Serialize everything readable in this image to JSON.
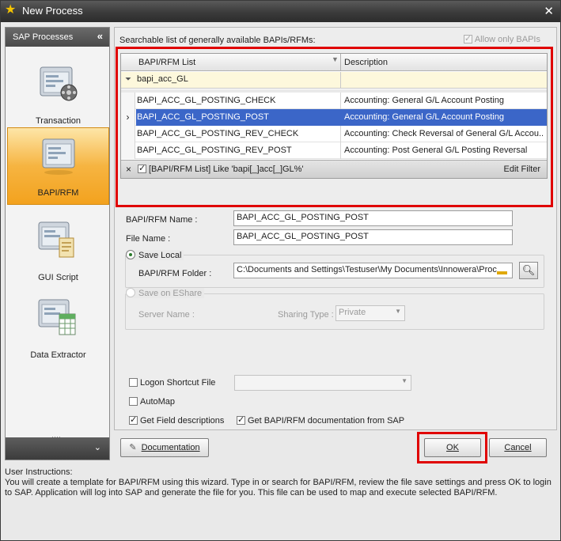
{
  "window": {
    "title": "New Process",
    "close_label": "✕"
  },
  "sidebar": {
    "header": "SAP Processes",
    "collapse_glyph": "«",
    "items": [
      {
        "label": "Transaction",
        "icon": "transaction-icon",
        "active": false
      },
      {
        "label": "BAPI/RFM",
        "icon": "bapi-rfm-icon",
        "active": true
      },
      {
        "label": "GUI Script",
        "icon": "gui-script-icon",
        "active": false
      },
      {
        "label": "Data Extractor",
        "icon": "data-extractor-icon",
        "active": false
      }
    ],
    "footer_glyph": "⌄"
  },
  "search": {
    "label": "Searchable list of generally available BAPIs/RFMs:",
    "allow_only_bapis": {
      "label": "Allow only BAPIs",
      "checked": true,
      "enabled": false
    }
  },
  "grid": {
    "columns": [
      "BAPI/RFM List",
      "Description"
    ],
    "filter_value": "bapi_acc_GL",
    "rows": [
      {
        "name": "BAPI_ACC_GL_POSTING_CHECK",
        "description": "Accounting: General G/L Account Posting",
        "selected": false
      },
      {
        "name": "BAPI_ACC_GL_POSTING_POST",
        "description": "Accounting: General G/L Account Posting",
        "selected": true
      },
      {
        "name": "BAPI_ACC_GL_POSTING_REV_CHECK",
        "description": "Accounting: Check Reversal of General G/L Accou...",
        "selected": false
      },
      {
        "name": "BAPI_ACC_GL_POSTING_REV_POST",
        "description": "Accounting: Post General G/L Posting Reversal",
        "selected": false
      }
    ],
    "selected_indicator": "›",
    "filter_bar": {
      "clear_glyph": "×",
      "text": "[BAPI/RFM List] Like 'bapi[_]acc[_]GL%'",
      "edit_label": "Edit Filter"
    }
  },
  "form": {
    "bapi_name_label": "BAPI/RFM Name :",
    "bapi_name_value": "BAPI_ACC_GL_POSTING_POST",
    "file_name_label": "File Name :",
    "file_name_value": "BAPI_ACC_GL_POSTING_POST",
    "save_local_label": "Save Local",
    "folder_label": "BAPI/RFM Folder :",
    "folder_value": "C:\\Documents and Settings\\Testuser\\My Documents\\Innowera\\Proc",
    "save_eshare_label": "Save on EShare",
    "server_name_label": "Server Name :",
    "sharing_type_label": "Sharing Type :",
    "sharing_type_value": "Private",
    "logon_shortcut_label": "Logon Shortcut File",
    "automap_label": "AutoMap",
    "get_field_desc_label": "Get Field descriptions",
    "get_doc_label": "Get BAPI/RFM documentation from SAP"
  },
  "buttons": {
    "documentation": "Documentation",
    "ok": "OK",
    "cancel": "Cancel"
  },
  "instructions": {
    "heading": "User Instructions:",
    "body": "You will create a template for BAPI/RFM using this wizard. Type in or search for BAPI/RFM, review the file save settings and press OK  to login to SAP. Application will log into SAP and generate the file for you. This file can be used to map and execute selected BAPI/RFM."
  },
  "colors": {
    "selection": "#3b66c8",
    "highlight_box": "#e00000",
    "active_sidebar": "#f3a21e"
  }
}
